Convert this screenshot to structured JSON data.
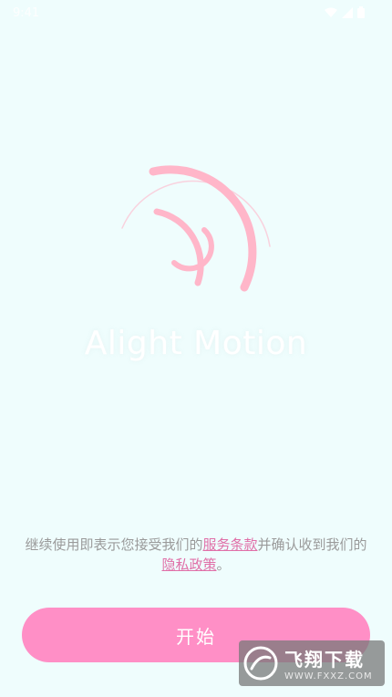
{
  "status_bar": {
    "time": "9:41"
  },
  "app_name": "Alight Motion",
  "terms": {
    "prefix": "继续使用即表示您接受我们的",
    "tos_link": "服务条款",
    "middle": "并确认收到我们的",
    "privacy_link": "隐私政策",
    "suffix": "。"
  },
  "start_button": {
    "label": "开始"
  },
  "watermark": {
    "title": "飞翔下载",
    "url": "WWW.FXXZ.COM"
  },
  "colors": {
    "accent": "#ff8fc6",
    "logo": "#ffb6c9",
    "background": "#effdfd"
  }
}
